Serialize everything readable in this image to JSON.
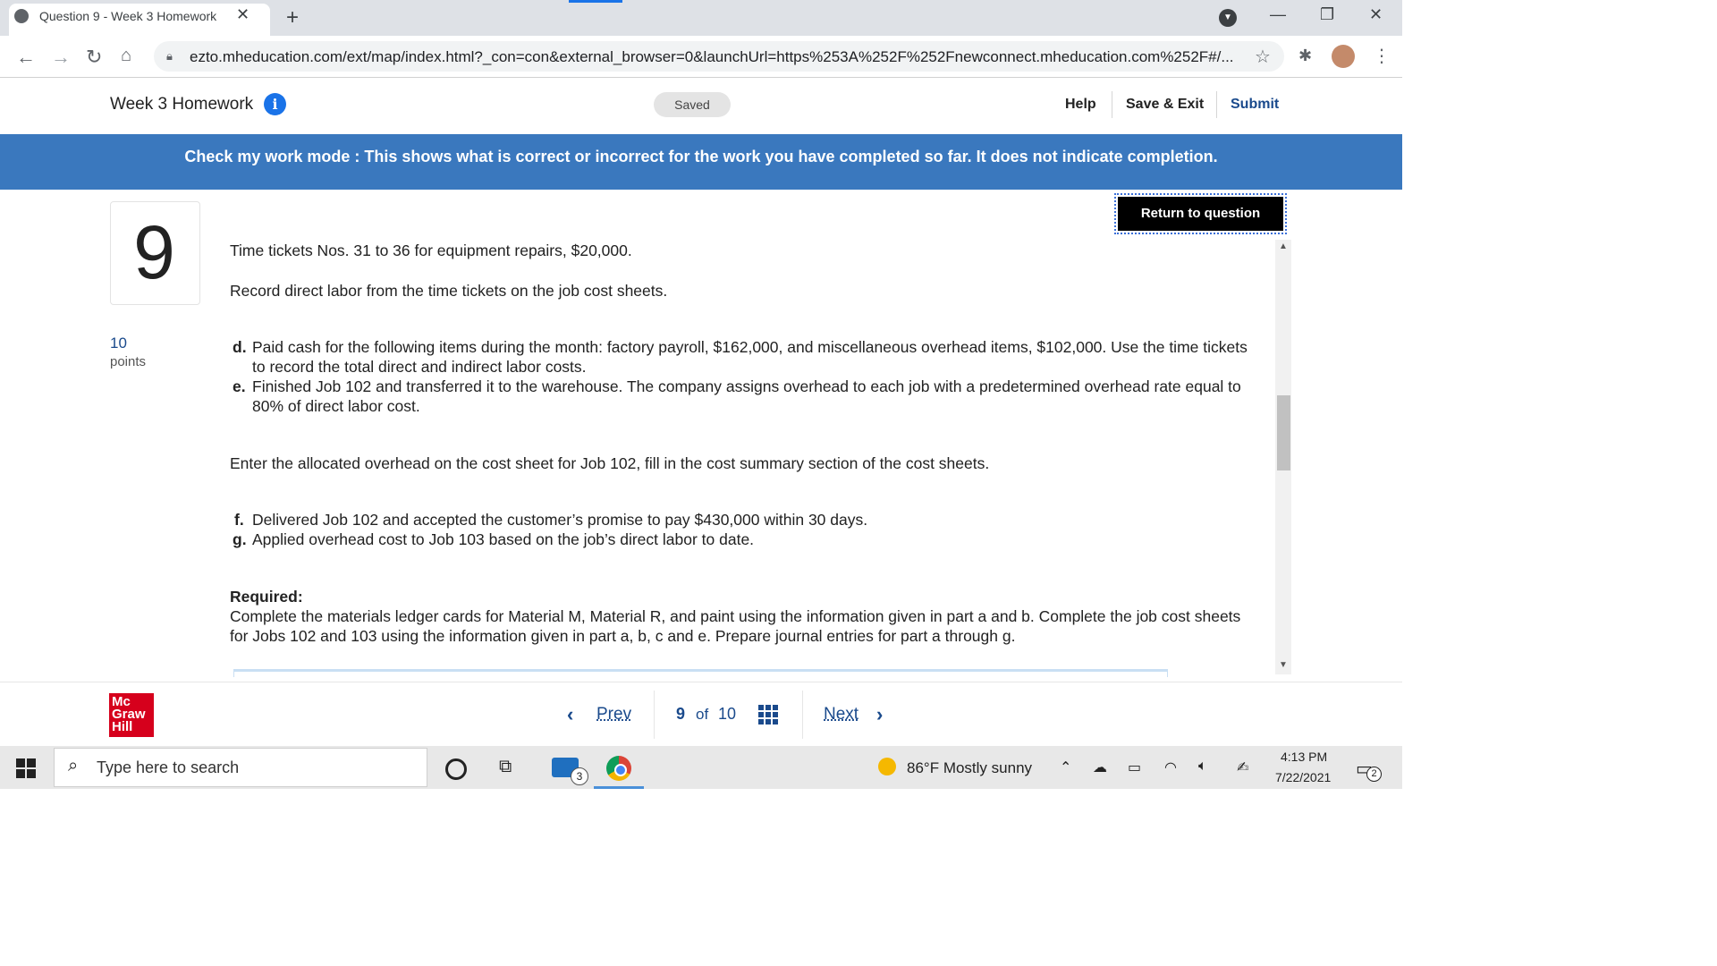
{
  "browser": {
    "tab_title": "Question 9 - Week 3 Homework",
    "url": "ezto.mheducation.com/ext/map/index.html?_con=con&external_browser=0&launchUrl=https%253A%252F%252Fnewconnect.mheducation.com%252F#/..."
  },
  "header": {
    "title": "Week 3 Homework",
    "saved": "Saved",
    "help": "Help",
    "save_exit": "Save & Exit",
    "submit": "Submit"
  },
  "banner": "Check my work mode : This shows what is correct or incorrect for the work you have completed so far. It does not indicate completion.",
  "question": {
    "number": "9",
    "points_value": "10",
    "points_label": "points",
    "return_button": "Return to question",
    "line1": "Time tickets Nos. 31 to 36 for equipment repairs, $20,000.",
    "line2": "Record direct labor from the time tickets on the job cost sheets.",
    "items_de": [
      {
        "letter": "d.",
        "text": "Paid cash for the following items during the month: factory payroll, $162,000, and miscellaneous overhead items, $102,000. Use the time tickets to record the total direct and indirect labor costs."
      },
      {
        "letter": "e.",
        "text": "Finished Job 102 and transferred it to the warehouse. The company assigns overhead to each job with a predetermined overhead rate equal to 80% of direct labor cost."
      }
    ],
    "line3": "Enter the allocated overhead on the cost sheet for Job 102, fill in the cost summary section of the cost sheets.",
    "items_fg": [
      {
        "letter": "f.",
        "text": "Delivered Job 102 and accepted the customer’s promise to pay $430,000 within 30 days."
      },
      {
        "letter": "g.",
        "text": "Applied overhead cost to Job 103 based on the job’s direct labor to date."
      }
    ],
    "required_label": "Required:",
    "required_text": "Complete the materials ledger cards for Material M, Material R, and paint using the information given in part a and b. Complete the job cost sheets for Jobs 102 and 103 using the information given in part a, b, c and e. Prepare journal entries for part a through g."
  },
  "footer": {
    "logo": "Mc Graw Hill",
    "prev": "Prev",
    "page_current": "9",
    "page_of": "of",
    "page_total": "10",
    "next": "Next"
  },
  "taskbar": {
    "search_placeholder": "Type here to search",
    "mail_badge": "3",
    "weather": "86°F  Mostly sunny",
    "time": "4:13 PM",
    "date": "7/22/2021",
    "notification_count": "2"
  }
}
